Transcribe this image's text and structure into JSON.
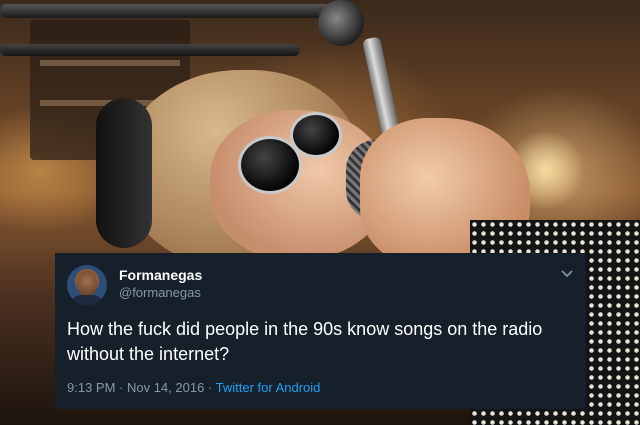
{
  "tweet": {
    "display_name": "Formanegas",
    "handle": "@formanegas",
    "text": "How the fuck did people in the 90s know songs on the radio without the internet?",
    "timestamp": "9:13 PM · Nov 14, 2016 · ",
    "source": "Twitter for Android",
    "menu_icon": "chevron-down-icon"
  },
  "colors": {
    "card_background": "#15202b",
    "primary_text": "#ffffff",
    "secondary_text": "#8899a6",
    "link": "#1da1f2"
  }
}
